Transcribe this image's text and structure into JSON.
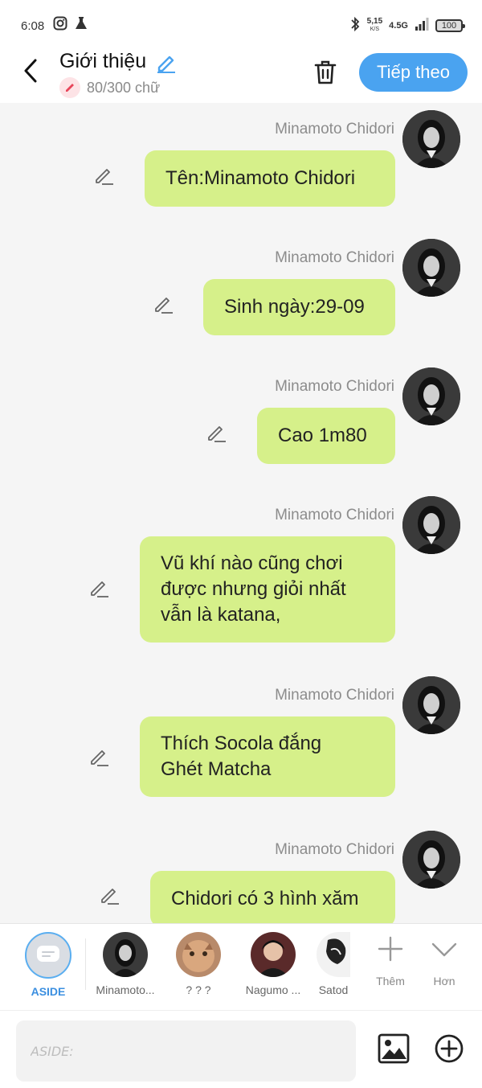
{
  "status_bar": {
    "time": "6:08",
    "net_speed_value": "5,15",
    "net_speed_unit": "K/S",
    "network": "4.5G",
    "battery": "100"
  },
  "header": {
    "title": "Giới thiệu",
    "char_count": "80/300 chữ",
    "next_label": "Tiếp theo"
  },
  "messages": [
    {
      "sender": "Minamoto Chidori",
      "text": "Tên:Minamoto Chidori"
    },
    {
      "sender": "Minamoto Chidori",
      "text": "Sinh ngày:29-09"
    },
    {
      "sender": "Minamoto Chidori",
      "text": "Cao 1m80"
    },
    {
      "sender": "Minamoto Chidori",
      "text": "Vũ khí nào cũng chơi\nđược nhưng giỏi nhất\nvẫn là katana,"
    },
    {
      "sender": "Minamoto Chidori",
      "text": "Thích Socola đắng\nGhét Matcha"
    },
    {
      "sender": "Minamoto Chidori",
      "text": "Chidori có 3 hình xăm"
    }
  ],
  "character_bar": {
    "aside_label": "ASIDE",
    "characters": [
      {
        "name": "Minamoto..."
      },
      {
        "name": "? ? ?"
      },
      {
        "name": "Nagumo ..."
      },
      {
        "name": "Satod"
      }
    ],
    "add_label": "Thêm",
    "more_label": "Hơn"
  },
  "input_bar": {
    "placeholder": "ASIDE:"
  },
  "colors": {
    "accent": "#4aa3f0",
    "bubble": "#d6f08a",
    "background": "#f5f5f5"
  }
}
